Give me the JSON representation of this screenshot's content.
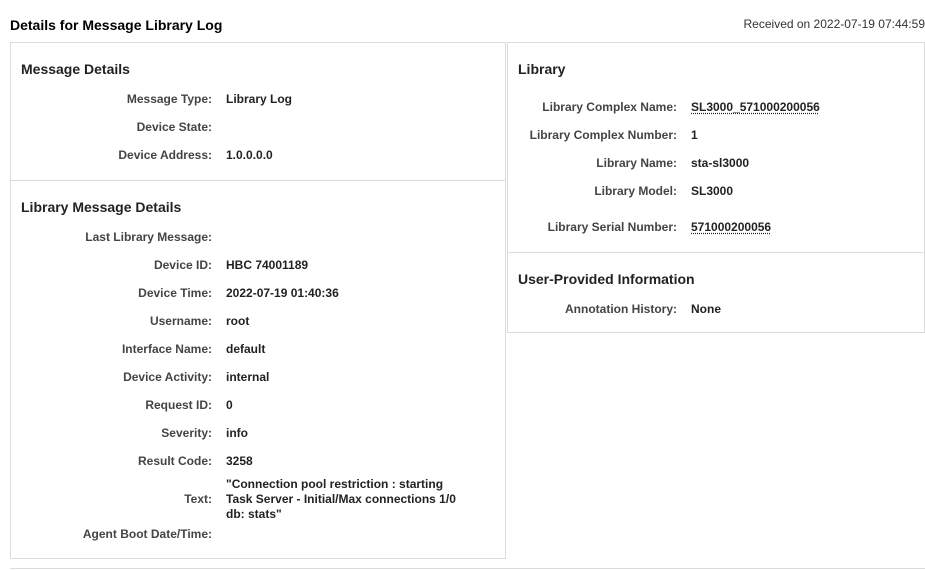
{
  "header": {
    "title": "Details for Message Library Log",
    "received": "Received on 2022-07-19 07:44:59"
  },
  "message_details": {
    "title": "Message Details",
    "rows": [
      {
        "label": "Message Type:",
        "value": "Library Log"
      },
      {
        "label": "Device State:",
        "value": ""
      },
      {
        "label": "Device Address:",
        "value": "1.0.0.0.0"
      }
    ]
  },
  "library_message_details": {
    "title": "Library Message Details",
    "rows": [
      {
        "label": "Last Library Message:",
        "value": ""
      },
      {
        "label": "Device ID:",
        "value": "HBC 74001189"
      },
      {
        "label": "Device Time:",
        "value": "2022-07-19 01:40:36"
      },
      {
        "label": "Username:",
        "value": "root"
      },
      {
        "label": "Interface Name:",
        "value": "default"
      },
      {
        "label": "Device Activity:",
        "value": "internal"
      },
      {
        "label": "Request ID:",
        "value": "0"
      },
      {
        "label": "Severity:",
        "value": "info"
      },
      {
        "label": "Result Code:",
        "value": "3258"
      },
      {
        "label": "Text:",
        "value": "\"Connection pool restriction : starting Task Server - Initial/Max connections 1/0 db: stats\""
      },
      {
        "label": "Agent Boot Date/Time:",
        "value": ""
      }
    ]
  },
  "library": {
    "title": "Library",
    "rows": [
      {
        "label": "Library Complex Name:",
        "value": "SL3000_571000200056"
      },
      {
        "label": "Library Complex Number:",
        "value": "1"
      },
      {
        "label": "Library Name:",
        "value": "sta-sl3000"
      },
      {
        "label": "Library Model:",
        "value": "SL3000"
      },
      {
        "label": "Library Serial Number:",
        "value": "571000200056"
      }
    ]
  },
  "user_info": {
    "title": "User-Provided Information",
    "rows": [
      {
        "label": "Annotation History:",
        "value": "None"
      }
    ]
  },
  "colors": {
    "link": "#1f4e8c",
    "border": "#dcdcdc"
  }
}
